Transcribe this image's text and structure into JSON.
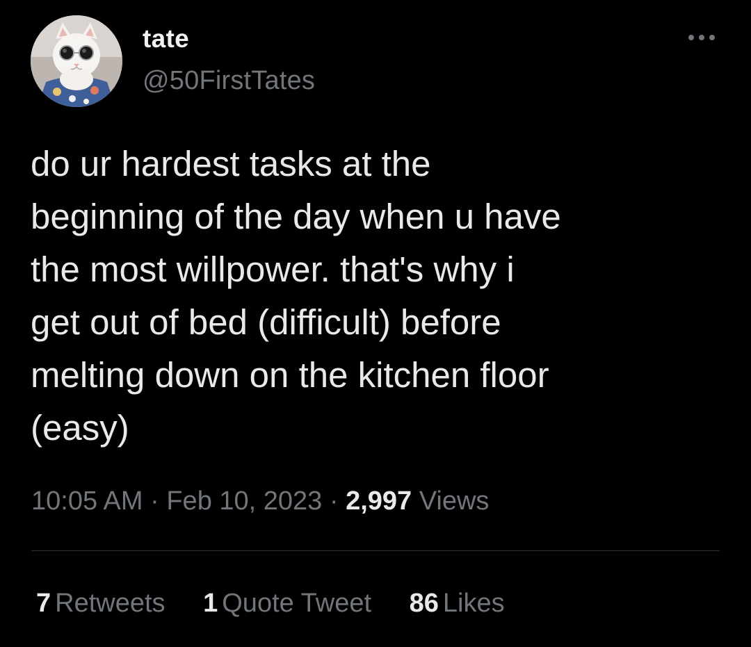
{
  "author": {
    "display_name": "tate",
    "handle": "@50FirstTates",
    "avatar_icon": "cat-with-sunglasses-avatar"
  },
  "menu": {
    "more_icon": "more-dots-icon"
  },
  "tweet": {
    "text": "do ur hardest tasks at the\nbeginning of the day when u have\nthe most willpower. that's why i\nget out of bed (difficult) before\nmelting down on the kitchen floor\n(easy)",
    "time": "10:05 AM",
    "separator": "·",
    "date": "Feb 10, 2023",
    "views_count": "2,997",
    "views_label": "Views"
  },
  "stats": {
    "retweets_count": "7",
    "retweets_label": "Retweets",
    "quotes_count": "1",
    "quotes_label": "Quote Tweet",
    "likes_count": "86",
    "likes_label": "Likes"
  },
  "colors": {
    "background": "#000000",
    "primary_text": "#e7e9ea",
    "secondary_text": "#71767b",
    "divider": "#2f3336"
  }
}
